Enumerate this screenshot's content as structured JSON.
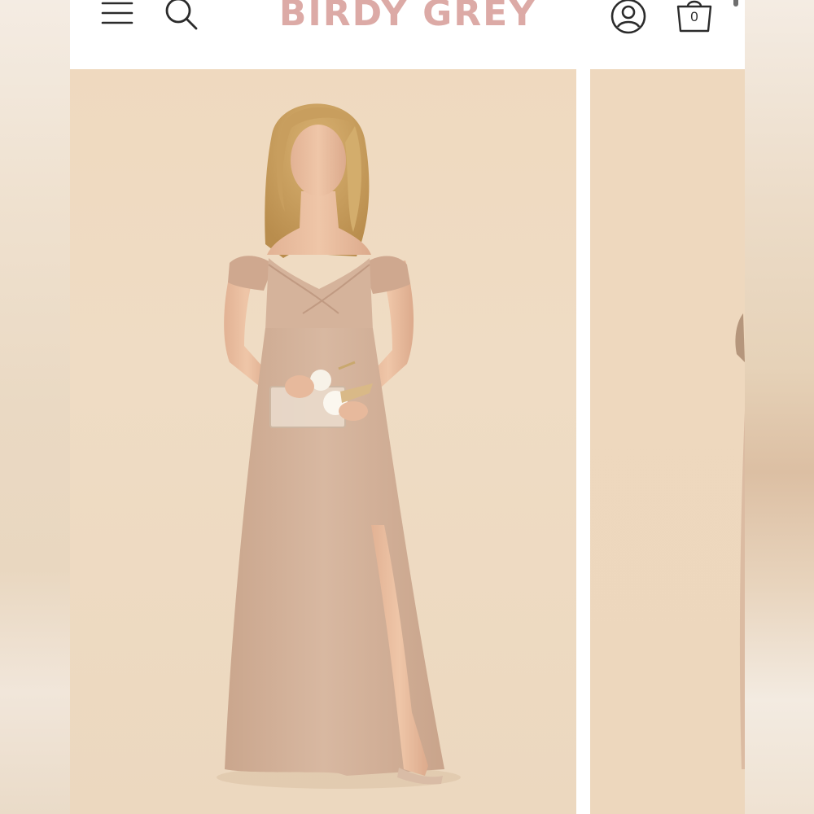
{
  "header": {
    "logo_text": "BIRDY GREY",
    "cart_count": "0",
    "icons": {
      "menu": "menu-icon",
      "search": "search-icon",
      "account": "account-icon",
      "cart": "cart-icon"
    }
  },
  "gallery": {
    "slides": [
      {
        "name": "product-image-1",
        "description_visible": false
      },
      {
        "name": "product-image-2",
        "description_visible": false
      }
    ]
  },
  "colors": {
    "brand_pink": "#dcaaa6",
    "dress": "#d5b39b",
    "backdrop": "#efd9bf",
    "icon": "#2b2b2b"
  }
}
